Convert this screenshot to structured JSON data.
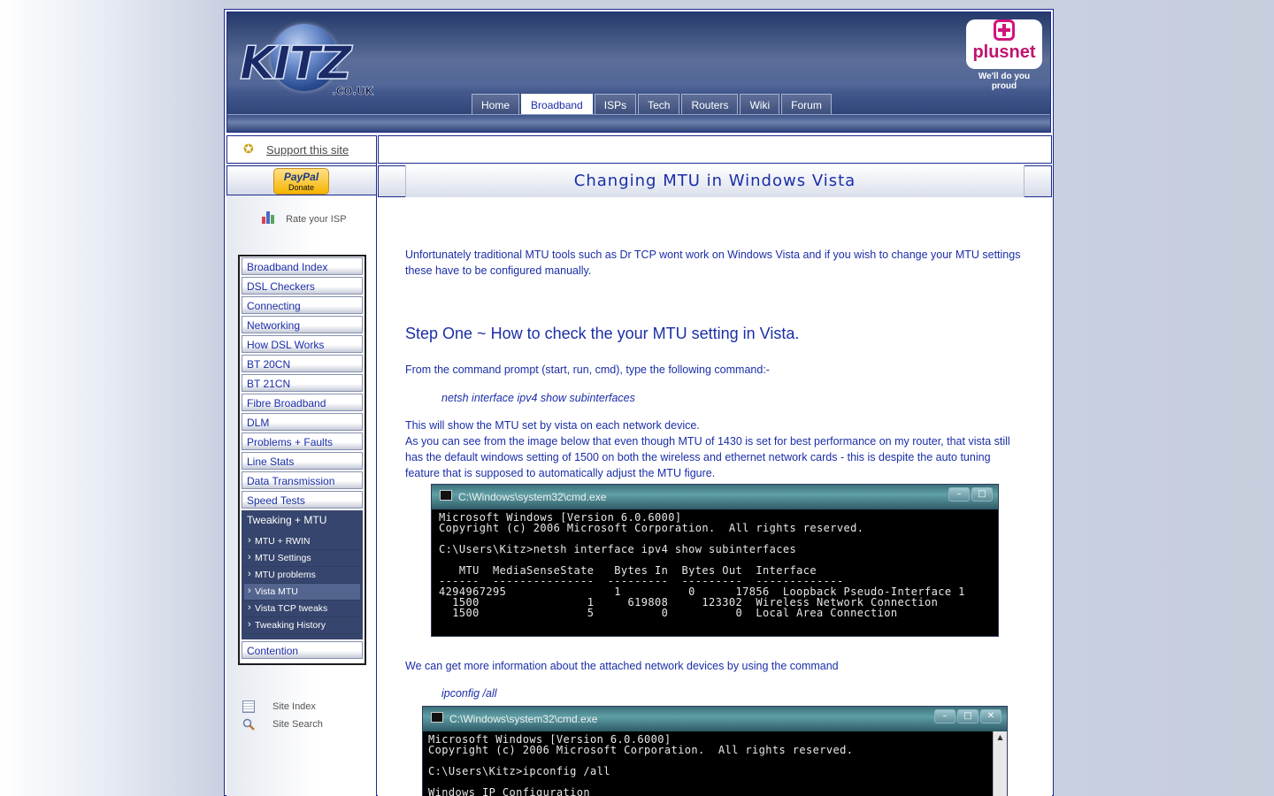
{
  "header": {
    "logo_text": "KITZ",
    "logo_sub": ".CO.UK",
    "sponsor_name": "plusnet",
    "sponsor_tagline": "We'll do you proud",
    "nav": [
      "Home",
      "Broadband",
      "ISPs",
      "Tech",
      "Routers",
      "Wiki",
      "Forum"
    ],
    "active_nav": "Broadband"
  },
  "sidebar": {
    "support_label": "Support this site",
    "paypal_brand": "PayPal",
    "paypal_label": "Donate",
    "rate_label": "Rate your ISP",
    "menu": [
      "Broadband Index",
      "DSL Checkers",
      "Connecting",
      "Networking",
      "How DSL Works",
      "BT 20CN",
      "BT 21CN",
      "Fibre Broadband",
      "DLM",
      "Problems + Faults",
      "Line Stats",
      "Data Transmission",
      "Speed Tests",
      "Tweaking + MTU",
      "Contention"
    ],
    "submenu": [
      "MTU + RWIN",
      "MTU Settings",
      "MTU problems",
      "Vista MTU",
      "Vista TCP tweaks",
      "Tweaking History"
    ],
    "active_sub": "Vista MTU",
    "footer_links": [
      "Site Index",
      "Site Search"
    ]
  },
  "page": {
    "title": "Changing MTU in Windows Vista",
    "intro": "Unfortunately traditional MTU tools such as Dr TCP wont work on Windows Vista and if you wish to change your MTU settings these have to be configured manually.",
    "step_one_heading": "Step One ~ How to check the your MTU setting in Vista.",
    "step_one_text": "From the command prompt (start, run, cmd), type the following command:-",
    "command_1": "netsh interface ipv4 show subinterfaces",
    "result_line": "This will show the MTU set by vista on each network device.",
    "result_detail": "As you can see from the image below that even though MTU of 1430 is set for best performance on my router, that vista still has the default windows setting of 1500 on both the wireless and ethernet network cards - this is despite the auto tuning feature that is supposed to automatically adjust the MTU figure.",
    "more_info": "We can get more information about the attached network devices by using the command",
    "command_2": "ipconfig /all"
  },
  "cmd1": {
    "title": "C:\\Windows\\system32\\cmd.exe",
    "lines": [
      "Microsoft Windows [Version 6.0.6000]",
      "Copyright (c) 2006 Microsoft Corporation.  All rights reserved.",
      "",
      "C:\\Users\\Kitz>netsh interface ipv4 show subinterfaces",
      "",
      "   MTU  MediaSenseState   Bytes In  Bytes Out  Interface",
      "------  ---------------  ---------  ---------  -------------",
      "4294967295                1          0      17856  Loopback Pseudo-Interface 1",
      "  1500                1     619808     123302  Wireless Network Connection",
      "  1500                5          0          0  Local Area Connection"
    ]
  },
  "cmd2": {
    "title": "C:\\Windows\\system32\\cmd.exe",
    "lines": [
      "Microsoft Windows [Version 6.0.6000]",
      "Copyright (c) 2006 Microsoft Corporation.  All rights reserved.",
      "",
      "C:\\Users\\Kitz>ipconfig /all",
      "",
      "Windows IP Configuration"
    ]
  },
  "colors": {
    "link": "#1b2ea8",
    "border": "#1b2a8c",
    "submenu_bg": "#36456d",
    "plusnet": "#d1147d"
  }
}
